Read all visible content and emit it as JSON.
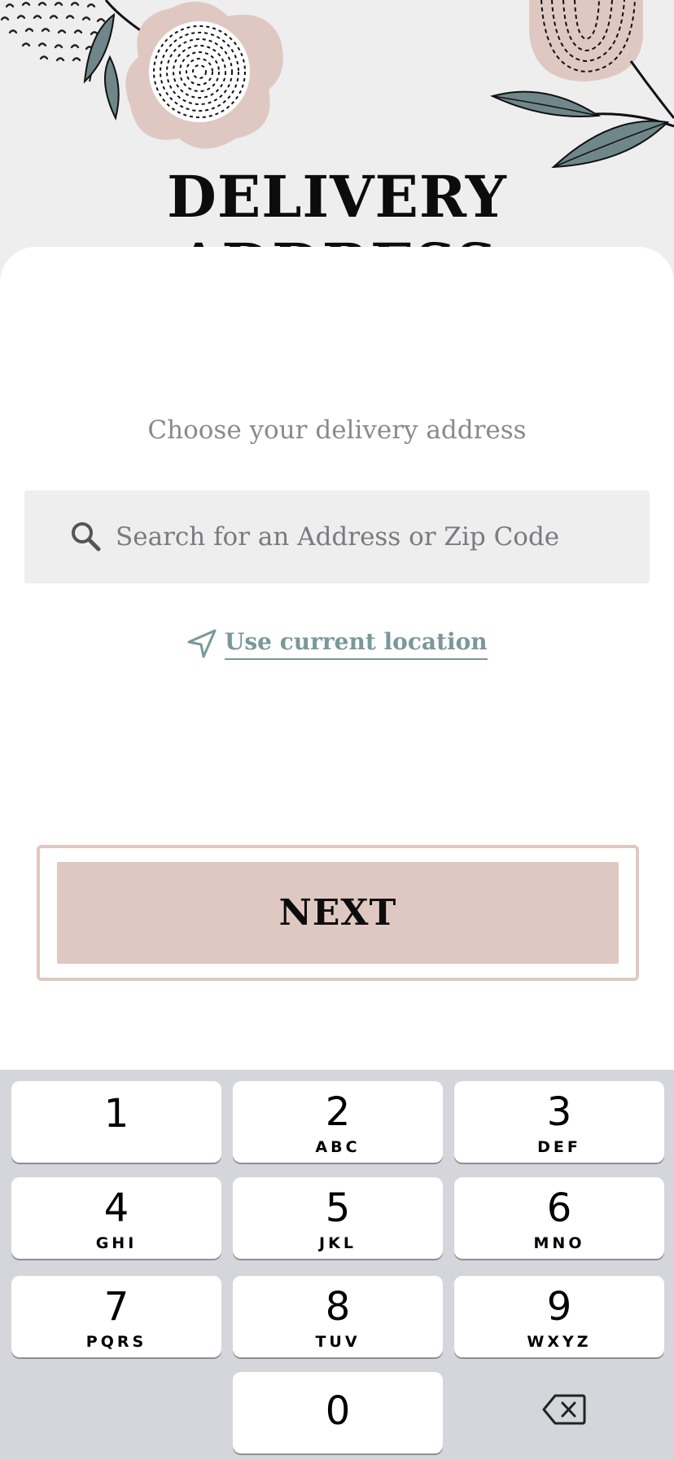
{
  "header": {
    "title": "DELIVERY ADDRESS"
  },
  "main": {
    "subtitle": "Choose your delivery address",
    "search": {
      "placeholder": "Search for an Address or Zip Code",
      "value": "",
      "icon": "search-icon"
    },
    "location_link": {
      "label": "Use current location",
      "icon": "navigation-arrow-icon"
    },
    "next_button": {
      "label": "NEXT"
    }
  },
  "keyboard": {
    "keys": [
      {
        "num": "1",
        "letters": ""
      },
      {
        "num": "2",
        "letters": "ABC"
      },
      {
        "num": "3",
        "letters": "DEF"
      },
      {
        "num": "4",
        "letters": "GHI"
      },
      {
        "num": "5",
        "letters": "JKL"
      },
      {
        "num": "6",
        "letters": "MNO"
      },
      {
        "num": "7",
        "letters": "PQRS"
      },
      {
        "num": "8",
        "letters": "TUV"
      },
      {
        "num": "9",
        "letters": "WXYZ"
      },
      {
        "num": "0",
        "letters": ""
      }
    ],
    "backspace_icon": "backspace-icon"
  },
  "colors": {
    "accent_pink": "#e0c8c2",
    "link_teal": "#7b989a",
    "leaf": "#6f878a",
    "background": "#eeeeee"
  }
}
